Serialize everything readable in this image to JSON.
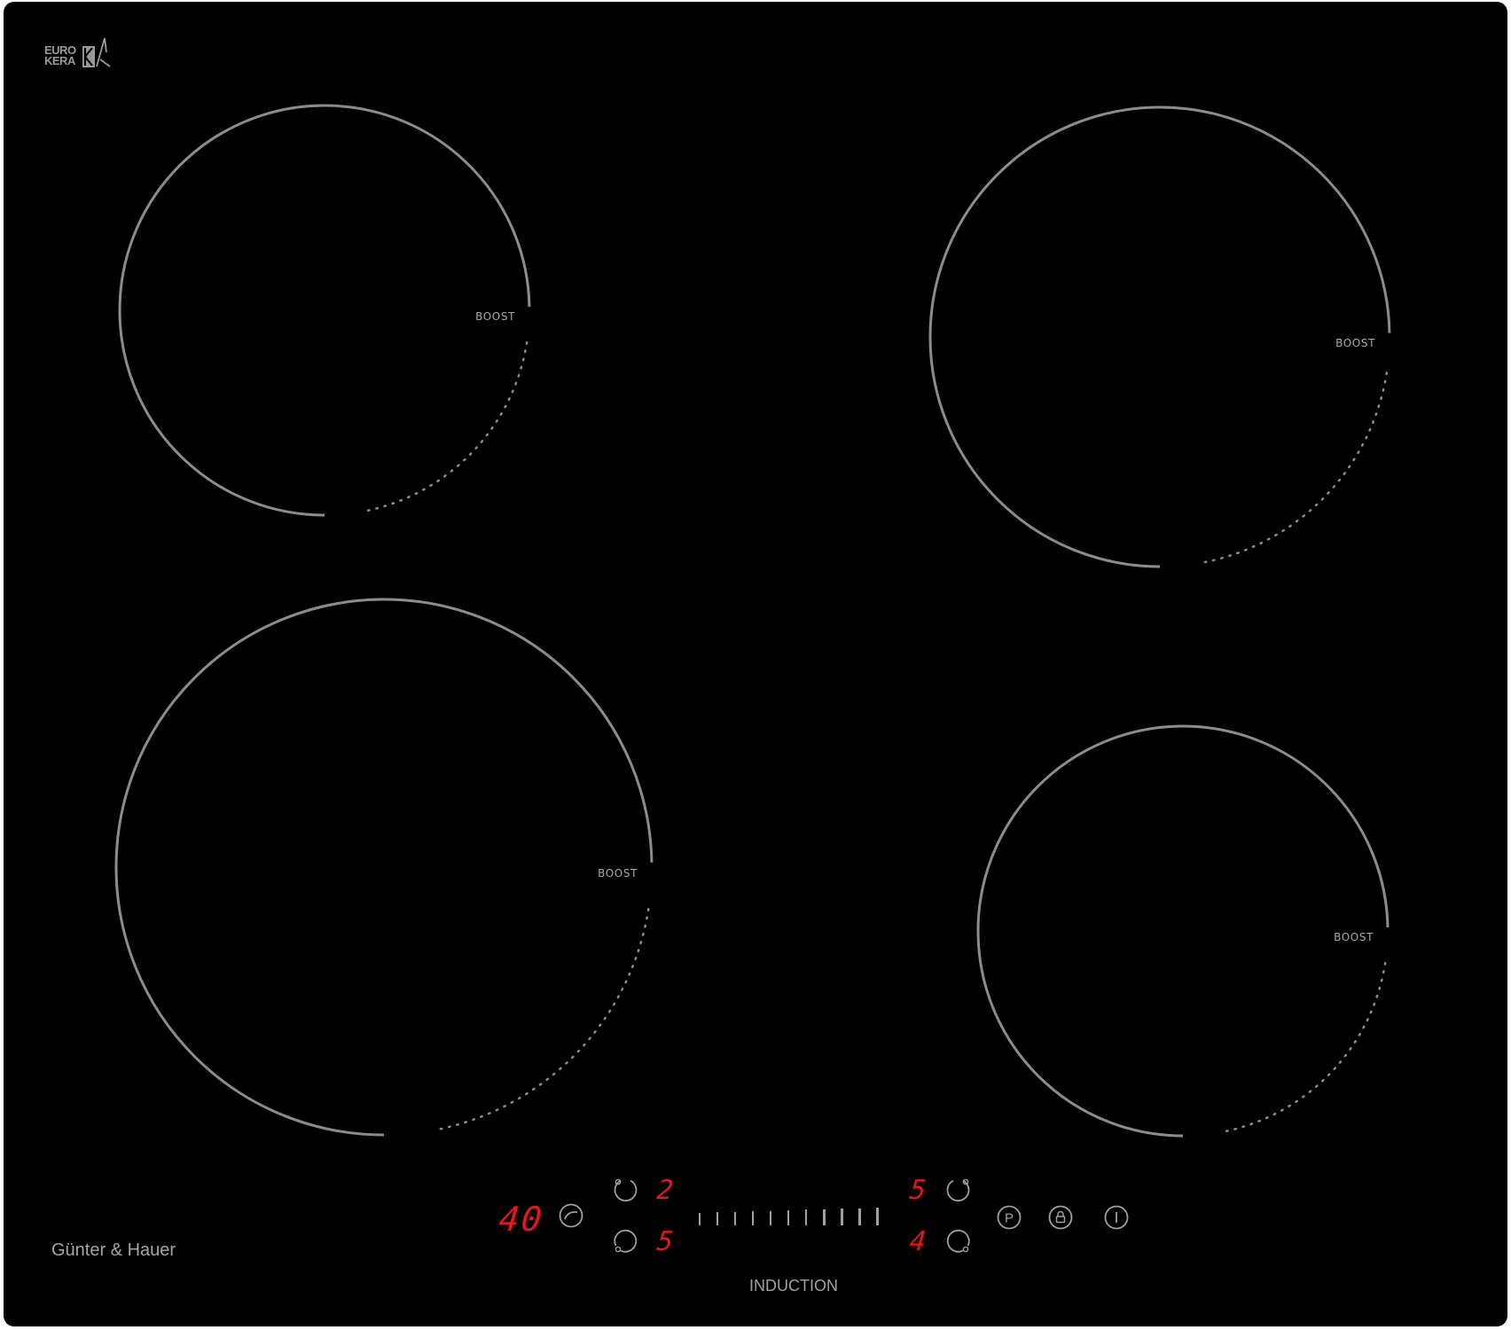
{
  "logo": {
    "line1": "EURO",
    "line2": "KERA",
    "icon": "eurokera-k-icon"
  },
  "zones": [
    {
      "id": "rear-left",
      "boost_label": "BOOST"
    },
    {
      "id": "rear-right",
      "boost_label": "BOOST"
    },
    {
      "id": "front-left",
      "boost_label": "BOOST"
    },
    {
      "id": "front-right",
      "boost_label": "BOOST"
    }
  ],
  "brand": "Günter & Hauer",
  "model": "INDUCTION",
  "controls": {
    "timer_display": "40",
    "timer_icon": "timer-icon",
    "zone_levels": {
      "rear_left": "2",
      "front_left": "5",
      "rear_right": "5",
      "front_right": "4"
    },
    "zone_select_icons": [
      "zone-rear-left-icon",
      "zone-front-left-icon",
      "zone-rear-right-icon",
      "zone-front-right-icon"
    ],
    "slider_ticks": 11,
    "pause_label": "P",
    "pause_icon": "pause-p-icon",
    "lock_icon": "lock-icon",
    "power_icon": "power-icon"
  },
  "colors": {
    "glass": "#000000",
    "ring": "#8c8c8c",
    "display_red": "#e8151b",
    "print": "#a0a0a0"
  }
}
